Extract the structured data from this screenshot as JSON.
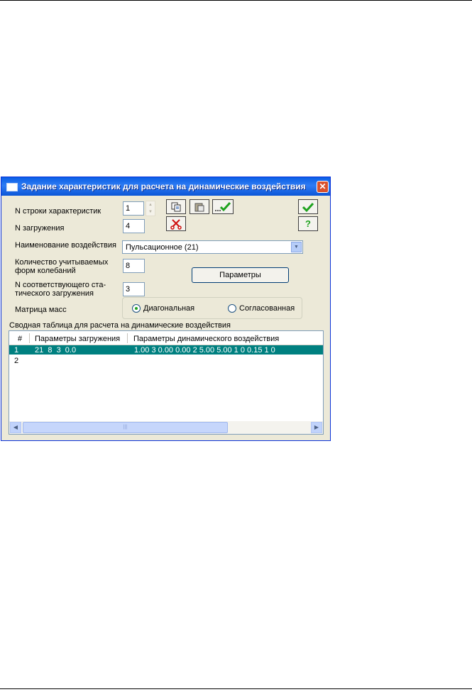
{
  "window": {
    "title": "Задание характеристик для расчета на динамические воздействия",
    "close_glyph": "✕"
  },
  "fields": {
    "char_row_label": "N строки характеристик",
    "char_row_value": "1",
    "load_label": "N загружения",
    "load_value": "4",
    "action_name_label": "Наименование воздействия",
    "action_name_value": "Пульсационное (21)",
    "modes_label_line1": "Количество учитываемых",
    "modes_label_line2": "форм колебаний",
    "modes_value": "8",
    "static_load_label_line1": "N соответствующего ста-",
    "static_load_label_line2": "тического загружения",
    "static_load_value": "3",
    "mass_matrix_label": "Матрица масс"
  },
  "toolbar": {
    "copy_icon": "copy-icon",
    "paste_icon": "paste-icon",
    "apply_icon": "apply-check-icon",
    "delete_icon": "scissors-icon",
    "ok_icon": "ok-check-icon",
    "help_icon": "help-icon",
    "help_glyph": "?"
  },
  "buttons": {
    "parameters": "Параметры"
  },
  "mass_matrix": {
    "options": [
      "Диагональная",
      "Согласованная"
    ],
    "selected": "Диагональная"
  },
  "table": {
    "title": "Сводная таблица для расчета на динамические воздействия",
    "columns": [
      "#",
      "Параметры загружения",
      "Параметры динамического воздействия"
    ],
    "rows": [
      {
        "num": "1",
        "load_params": "21  8  3  0.0",
        "dyn_params": "1.00 3 0.00 0.00 2 5.00 5.00 1 0 0.15 1 0",
        "selected": true
      },
      {
        "num": "2",
        "load_params": "",
        "dyn_params": "",
        "selected": false
      }
    ]
  },
  "colors": {
    "title_bar": "#0a5fe6",
    "dialog_bg": "#ece9d8",
    "selection": "#008080",
    "check_green": "#1ea21e",
    "scissors_red": "#d01010"
  }
}
